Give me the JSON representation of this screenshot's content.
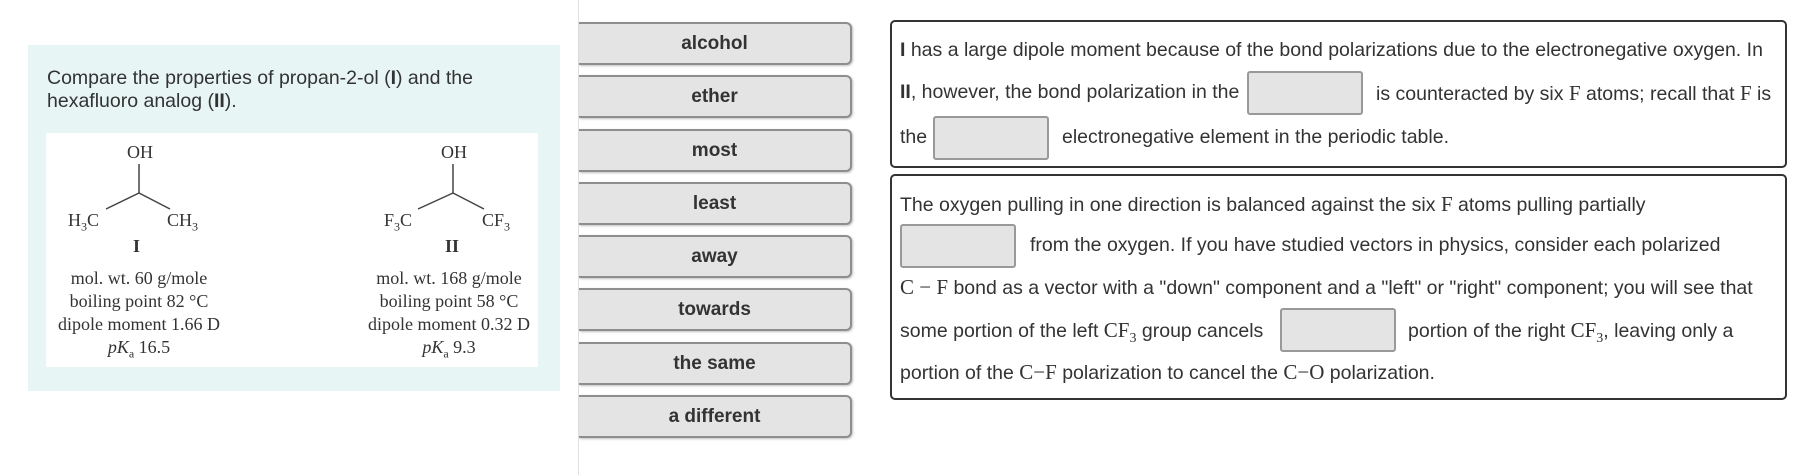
{
  "question": {
    "text_part1": "Compare the properties of propan-2-ol (",
    "mol1_label": "I",
    "text_part2": ") and the hexafluoro analog (",
    "mol2_label": "II",
    "text_part3": ")."
  },
  "molecules": [
    {
      "top_group": "OH",
      "left_group_main": "H",
      "left_group_sub": "3",
      "left_group_tail": "C",
      "right_group_main": "CH",
      "right_group_sub": "3",
      "label": "I",
      "mol_wt": "mol. wt. 60 g/mole",
      "bp": "boiling point 82 °C",
      "dipole": "dipole moment 1.66 D",
      "pka_prefix": "pK",
      "pka_sub": "a",
      "pka_value": " 16.5"
    },
    {
      "top_group": "OH",
      "left_group_main": "F",
      "left_group_sub": "3",
      "left_group_tail": "C",
      "right_group_main": "CF",
      "right_group_sub": "3",
      "label": "II",
      "mol_wt": "mol. wt. 168 g/mole",
      "bp": "boiling point 58 °C",
      "dipole": "dipole moment 0.32 D",
      "pka_prefix": "pK",
      "pka_sub": "a",
      "pka_value": " 9.3"
    }
  ],
  "answer_bank": [
    "alcohol",
    "ether",
    "most",
    "least",
    "away",
    "towards",
    "the same",
    "a different"
  ],
  "box1": {
    "l1_bold": "I",
    "l1_text": " has a large dipole moment because of the bond polarizations due to the electronegative oxygen. In",
    "l2_bold": "II",
    "l2_text_a": ", however, the bond polarization in the",
    "l2_text_b": "is counteracted by six ",
    "l2_F1": "F",
    "l2_text_c": " atoms; recall that ",
    "l2_F2": "F",
    "l2_text_d": " is",
    "l3_text_a": "the",
    "l3_text_b": "electronegative element in the periodic table."
  },
  "box2": {
    "l1_text_a": "The oxygen pulling in one direction is balanced against the six ",
    "l1_F": "F",
    "l1_text_b": " atoms pulling partially",
    "l2_text": "from the oxygen. If you have studied vectors in physics, consider each polarized",
    "l3_math": "C − F",
    "l3_text": " bond as a vector with a \"down\" component and a \"left\" or \"right\" component; you will see that",
    "l4_text_a": "some portion of the left ",
    "l4_math_a": "CF",
    "l4_sub_a": "3",
    "l4_text_b": " group cancels",
    "l4_text_c": "portion of the right ",
    "l4_math_b": "CF",
    "l4_sub_b": "3",
    "l4_text_d": ", leaving only a",
    "l5_text_a": "portion of the ",
    "l5_math_a": "C−F",
    "l5_text_b": " polarization to cancel the ",
    "l5_math_b": "C−O",
    "l5_text_c": " polarization."
  }
}
